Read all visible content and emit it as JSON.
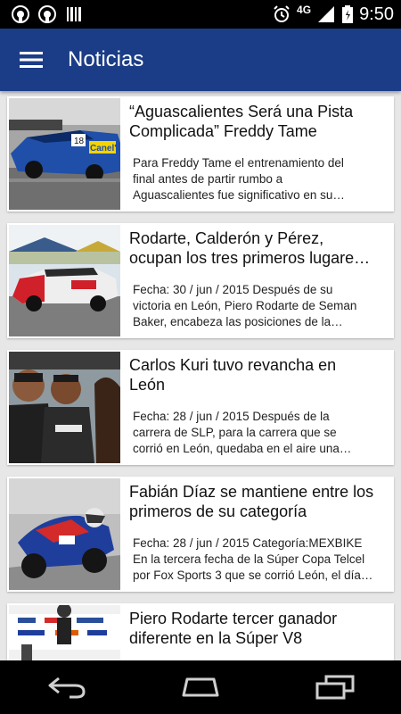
{
  "status_bar": {
    "network": "4G",
    "time": "9:50",
    "left_icons": [
      "notification-icon",
      "notification-icon",
      "barcode-icon"
    ],
    "right_icons": [
      "alarm-icon",
      "signal-icon",
      "battery-icon"
    ]
  },
  "app_bar": {
    "title": "Noticias",
    "menu_icon": "hamburger-menu-icon",
    "color": "#1b3d87"
  },
  "articles": [
    {
      "title_lines": [
        "“Aguascalientes Será una Pista",
        "Complicada” Freddy Tame"
      ],
      "body_lines": [
        "Para Freddy Tame el entrenamiento del",
        "final antes de partir rumbo a",
        "Aguascalientes fue significativo en su…"
      ]
    },
    {
      "title_lines": [
        "Rodarte, Calderón y Pérez,",
        "ocupan los tres primeros lugare…"
      ],
      "body_lines": [
        "Fecha: 30 / jun / 2015 Después de su",
        "victoria en León, Piero Rodarte de Seman",
        "Baker, encabeza las posiciones de la…"
      ]
    },
    {
      "title_lines": [
        "Carlos Kuri tuvo revancha en",
        "León"
      ],
      "body_lines": [
        "Fecha: 28 / jun / 2015 Después de la",
        "carrera de SLP, para la carrera que se",
        "corrió en León, quedaba en el aire una…"
      ]
    },
    {
      "title_lines": [
        "Fabián Díaz se mantiene entre los",
        "primeros de su categoría"
      ],
      "body_lines": [
        "Fecha: 28 / jun / 2015 Categoría:MEXBIKE",
        "En la tercera fecha de la Súper Copa Telcel",
        "por Fox Sports 3 que se corrió León, el día…"
      ]
    },
    {
      "title_lines": [
        "Piero Rodarte tercer ganador",
        "diferente en la Súper V8"
      ],
      "body_lines": [
        "",
        "",
        ""
      ]
    }
  ],
  "nav_bar": {
    "icons": [
      "back-icon",
      "home-icon",
      "recent-apps-icon"
    ]
  }
}
